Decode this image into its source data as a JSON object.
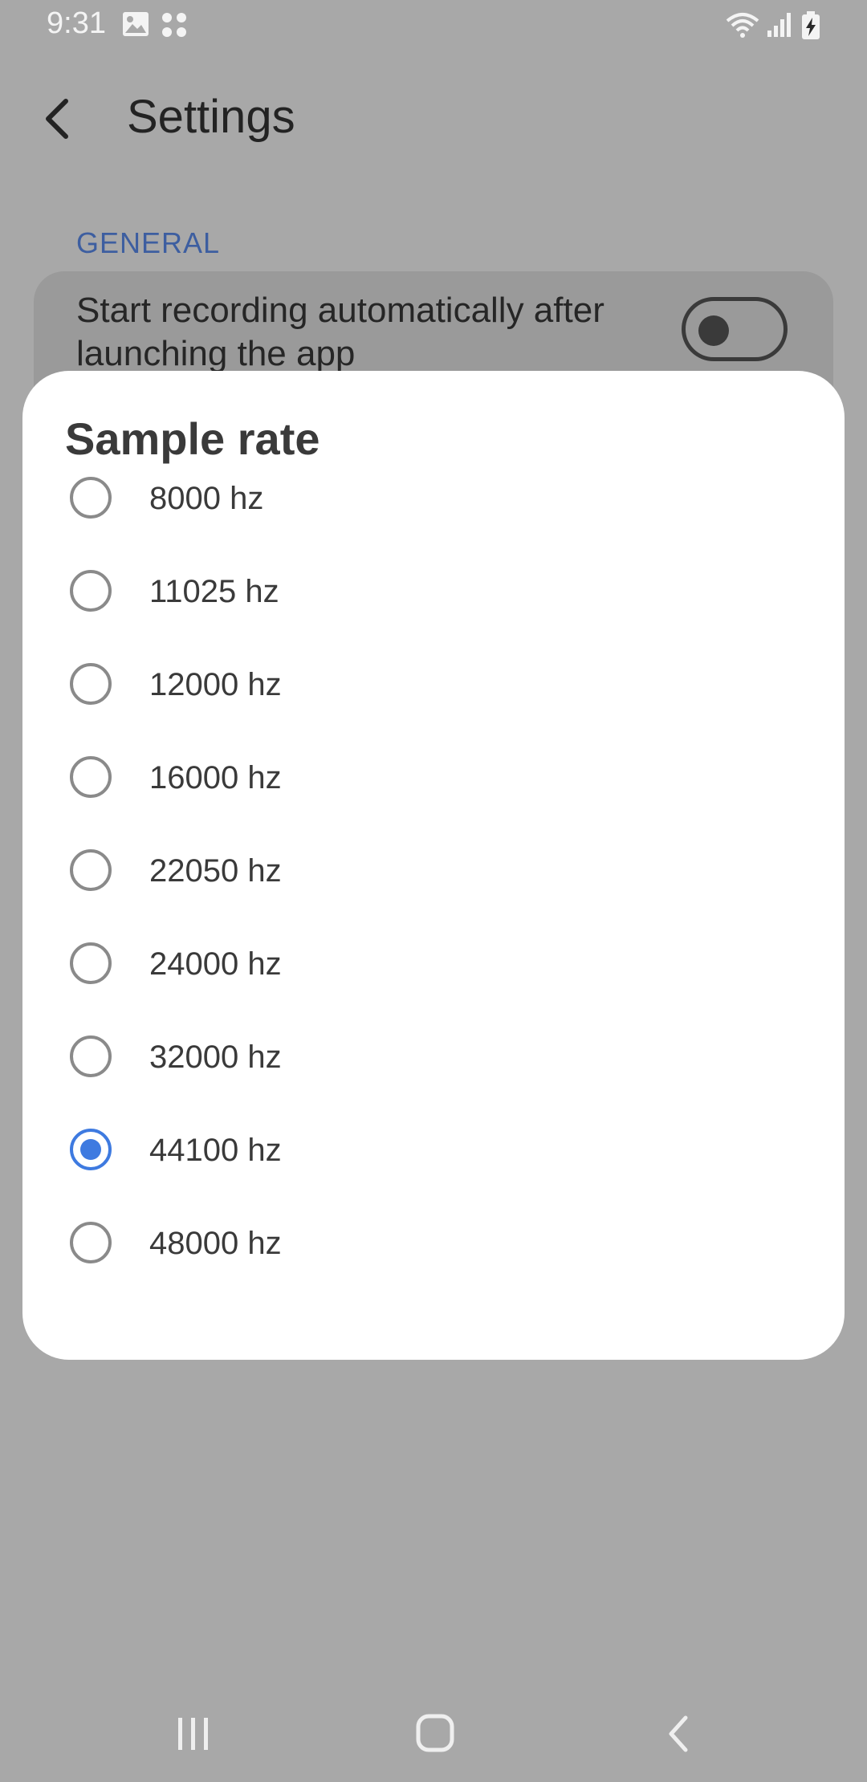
{
  "status_bar": {
    "time": "9:31",
    "left_icons": [
      "gallery-icon",
      "apps-icon"
    ],
    "right_icons": [
      "wifi-icon",
      "signal-icon",
      "battery-charging-icon"
    ]
  },
  "header": {
    "back_icon": "back-arrow-icon",
    "title": "Settings"
  },
  "general": {
    "section_label": "GENERAL",
    "auto_record": {
      "label": "Start recording automatically after launching the app",
      "enabled": false
    }
  },
  "dialog": {
    "title": "Sample rate",
    "options": [
      {
        "label": "8000 hz",
        "selected": false
      },
      {
        "label": "11025 hz",
        "selected": false
      },
      {
        "label": "12000 hz",
        "selected": false
      },
      {
        "label": "16000 hz",
        "selected": false
      },
      {
        "label": "22050 hz",
        "selected": false
      },
      {
        "label": "24000 hz",
        "selected": false
      },
      {
        "label": "32000 hz",
        "selected": false
      },
      {
        "label": "44100 hz",
        "selected": true
      },
      {
        "label": "48000 hz",
        "selected": false
      }
    ]
  },
  "nav_bar": {
    "buttons": [
      "recent-apps-icon",
      "home-icon",
      "back-icon"
    ]
  },
  "colors": {
    "accent": "#3e7ae0",
    "section_label": "#3d5ea0",
    "scrim_background": "#a8a8a8",
    "dialog_background": "#ffffff"
  }
}
